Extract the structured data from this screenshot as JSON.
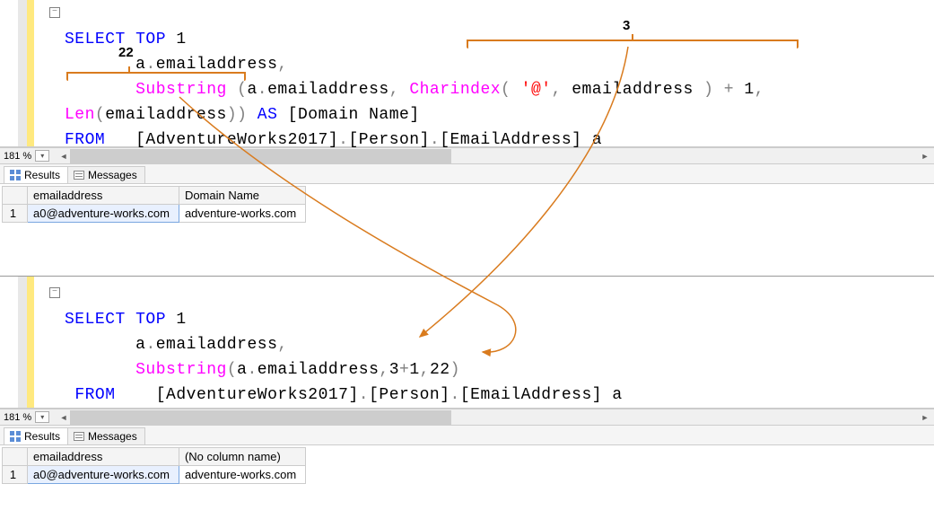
{
  "colors": {
    "keyword": "#0000ff",
    "function": "#ff00ff",
    "string": "#ff0000",
    "operator": "#808080",
    "annotation": "#d97b1e"
  },
  "zoom": "181 %",
  "pane1": {
    "code": {
      "l1": {
        "kw1": "SELECT",
        "kw2": "TOP",
        "num": "1"
      },
      "l2": {
        "a": "a",
        "dot": ".",
        "col": "emailaddress",
        "comma": ","
      },
      "l3": {
        "fn1": "Substring",
        "open": " (",
        "a": "a",
        "dot1": ".",
        "col1": "emailaddress",
        "comma1": ",",
        "sp": " ",
        "fn2": "Charindex",
        "open2": "(",
        "sp2": " ",
        "str": "'@'",
        "comma2": ",",
        "sp3": " ",
        "col2": "emailaddress",
        "sp4": " ",
        "close2": ")",
        "sp5": " ",
        "plus": "+",
        "sp6": " ",
        "one": "1",
        "comma3": ","
      },
      "l4": {
        "fn": "Len",
        "open": "(",
        "col": "emailaddress",
        "close": ")",
        "close2": ")",
        "sp": " ",
        "as": "AS",
        "sp2": " ",
        "alias": "[Domain Name]"
      },
      "l5": {
        "kw": "FROM",
        "sp": "   ",
        "tbl": "[AdventureWorks2017]",
        "dot1": ".",
        "sch": "[Person]",
        "dot2": ".",
        "obj": "[EmailAddress]",
        "sp2": " ",
        "a": "a"
      }
    },
    "tabs": {
      "results": "Results",
      "messages": "Messages"
    },
    "grid": {
      "headers": [
        "",
        "emailaddress",
        "Domain Name"
      ],
      "rows": [
        {
          "n": "1",
          "cells": [
            "a0@adventure-works.com",
            "adventure-works.com"
          ]
        }
      ]
    }
  },
  "pane2": {
    "code": {
      "l1": {
        "kw1": "SELECT",
        "kw2": "TOP",
        "num": "1"
      },
      "l2": {
        "a": "a",
        "dot": ".",
        "col": "emailaddress",
        "comma": ","
      },
      "l3": {
        "fn": "Substring",
        "open": "(",
        "a": "a",
        "dot": ".",
        "col": "emailaddress",
        "comma": ",",
        "n1": "3",
        "plus": "+",
        "n2": "1",
        "comma2": ",",
        "n3": "22",
        "close": ")"
      },
      "l4": {
        "kw": "FROM",
        "sp": "    ",
        "tbl": "[AdventureWorks2017]",
        "dot1": ".",
        "sch": "[Person]",
        "dot2": ".",
        "obj": "[EmailAddress]",
        "sp2": " ",
        "a": "a"
      }
    },
    "tabs": {
      "results": "Results",
      "messages": "Messages"
    },
    "grid": {
      "headers": [
        "",
        "emailaddress",
        "(No column name)"
      ],
      "rows": [
        {
          "n": "1",
          "cells": [
            "a0@adventure-works.com",
            "adventure-works.com"
          ]
        }
      ]
    }
  },
  "annotations": {
    "label_3": "3",
    "label_22": "22"
  }
}
